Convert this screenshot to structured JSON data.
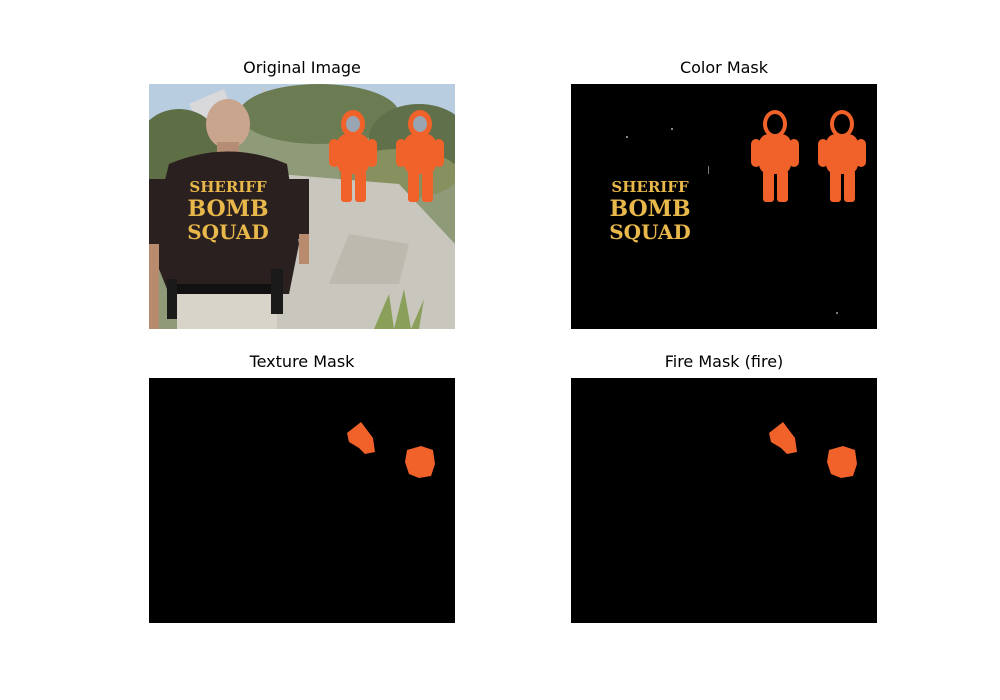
{
  "panels": [
    {
      "title": "Original Image"
    },
    {
      "title": "Color Mask"
    },
    {
      "title": "Texture Mask"
    },
    {
      "title": "Fire Mask (fire)"
    }
  ],
  "shirt_text": [
    "SHERIFF",
    "BOMB",
    "SQUAD"
  ],
  "colors": {
    "suit_orange": "#f0622a",
    "shirt_gold": "#e8b84a",
    "mask_background": "#000000",
    "shirt_dark": "#2a2020",
    "path_gray": "#c9c6bd",
    "vegetation": "#6f7f55",
    "sky": "#b9cde0"
  }
}
